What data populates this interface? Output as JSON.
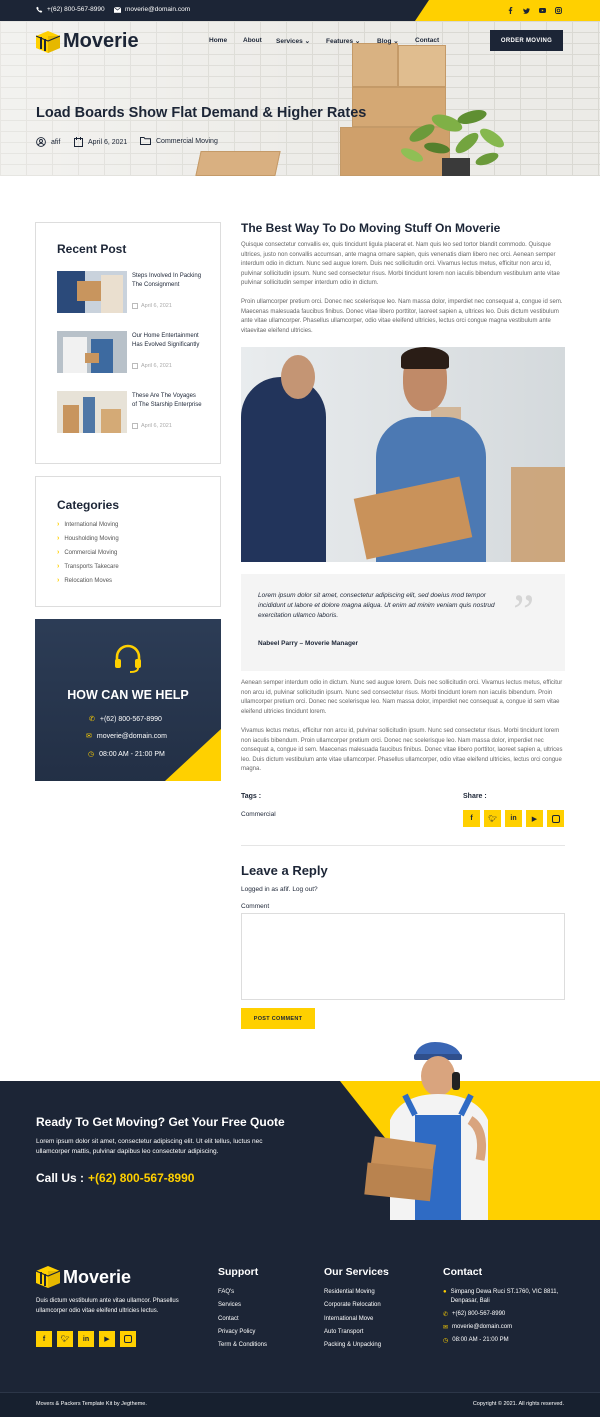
{
  "topbar": {
    "phone": "+(62) 800-567-8990",
    "email": "moverie@domain.com",
    "social": [
      "facebook-icon",
      "twitter-icon",
      "youtube-icon",
      "instagram-icon"
    ]
  },
  "brand": {
    "name": "Moverie",
    "accent": "#ffd000",
    "dark": "#1c2536"
  },
  "nav": {
    "items": [
      "Home",
      "About",
      "Services",
      "Features",
      "Blog",
      "Contact"
    ],
    "cta": "ORDER MOVING"
  },
  "hero": {
    "title": "Load Boards Show Flat Demand & Higher Rates",
    "author": "afif",
    "date": "April 6, 2021",
    "category": "Commercial Moving"
  },
  "sidebar": {
    "recent_title": "Recent Post",
    "recent": [
      {
        "title": "Steps Involved In Packing The Consignment",
        "date": "April 6, 2021"
      },
      {
        "title": "Our Home Entertainment Has Evolved Significantly",
        "date": "April 6, 2021"
      },
      {
        "title": "These Are The Voyages of The Starship Enterprise",
        "date": "April 6, 2021"
      }
    ],
    "categories_title": "Categories",
    "categories": [
      "International Moving",
      "Housholding Moving",
      "Commercial Moving",
      "Transports Takecare",
      "Relocation Moves"
    ],
    "help": {
      "title": "HOW CAN WE HELP",
      "phone": "+(62) 800-567-8990",
      "email": "moverie@domain.com",
      "hours": "08:00 AM - 21:00 PM"
    }
  },
  "article": {
    "heading": "The Best Way To Do Moving Stuff On Moverie",
    "p1": "Quisque consectetur convallis ex, quis tincidunt ligula placerat et. Nam quis leo sed tortor blandit commodo. Quisque ultrices, justo non convallis accumsan, ante magna ornare sapien, quis venenatis diam libero nec orci. Aenean semper interdum odio in dictum. Nunc sed augue lorem. Duis nec sollicitudin orci. Vivamus lectus metus, efficitur non arcu id, pulvinar sollicitudin ipsum. Nunc sed consectetur risus. Morbi tincidunt lorem non iaculis bibendum vestibulum ante vitae pulvinar sollicitudin semper interdum odio in dictum.",
    "p2": "Proin ullamcorper pretium orci. Donec nec scelerisque leo. Nam massa dolor, imperdiet nec consequat a, congue id sem. Maecenas malesuada faucibus finibus. Donec vitae libero porttitor, laoreet sapien a, ultrices leo. Duis dictum vestibulum ante vitae ullamcorper. Phasellus ullamcorper, odio vitae eleifend ultricies, lectus orci congue magna vestibulum ante vitaevitae eleifend ultricies.",
    "quote": "Lorem ipsum dolor sit amet, consectetur adipiscing elit, sed doeius mod tempor incididunt ut labore et dolore magna aliqua. Ut enim ad minim veniam quis nostrud exercitation ullamco laboris.",
    "quote_author": "Nabeel Parry – Moverie Manager",
    "p3": "Aenean semper interdum odio in dictum. Nunc sed augue lorem. Duis nec sollicitudin orci. Vivamus lectus metus, efficitur non arcu id, pulvinar sollicitudin ipsum. Nunc sed consectetur risus. Morbi tincidunt lorem non iaculis bibendum. Proin ullamcorper pretium orci. Donec nec scelerisque leo. Nam massa dolor, imperdiet nec consequat a, congue id sem vitae eleifend ultricies tincidunt lorem.",
    "p4": "Vivamus lectus metus, efficitur non arcu id, pulvinar sollicitudin ipsum. Nunc sed consectetur risus. Morbi tincidunt lorem non iaculis bibendum. Proin ullamcorper pretium orci. Donec nec scelerisque leo. Nam massa dolor, imperdiet nec consequat a, congue id sem. Maecenas malesuada faucibus finibus. Donec vitae libero porttitor, laoreet sapien a, ultrices leo. Duis dictum vestibulum ante vitae ullamcorper. Phasellus ullamcorper, odio vitae eleifend ultricies, lectus orci congue magna.",
    "tags_label": "Tags :",
    "tag": "Commercial",
    "share_label": "Share :"
  },
  "reply": {
    "title": "Leave a Reply",
    "logged": "Logged in as afif. Log out?",
    "comment_label": "Comment",
    "submit": "POST COMMENT"
  },
  "cta": {
    "title": "Ready To Get Moving? Get Your Free Quote",
    "text": "Lorem ipsum dolor sit amet, consectetur adipiscing elit. Ut elit tellus, luctus nec ullamcorper mattis, pulvinar dapibus leo consectetur adipiscing.",
    "call_label": "Call Us :",
    "phone": "+(62) 800-567-8990"
  },
  "footer": {
    "about": "Duis dictum vestibulum ante vitae ullamcor. Phasellus ullamcorper odio vitae eleifend ultricies lectus.",
    "support_title": "Support",
    "support": [
      "FAQ's",
      "Services",
      "Contact",
      "Privacy Policy",
      "Term & Conditions"
    ],
    "services_title": "Our Services",
    "services": [
      "Residential Moving",
      "Corporate Relocation",
      "International Move",
      "Auto Transport",
      "Packing & Unpacking"
    ],
    "contact_title": "Contact",
    "address": "Simpang Dewa Ruci ST.1760, VIC 8811, Denpasar, Bali",
    "phone": "+(62) 800-567-8990",
    "email": "moverie@domain.com",
    "hours": "08:00 AM - 21:00 PM",
    "credit": "Movers & Packers Template Kit by Jegtheme.",
    "copyright": "Copyright © 2021. All rights reserved."
  }
}
